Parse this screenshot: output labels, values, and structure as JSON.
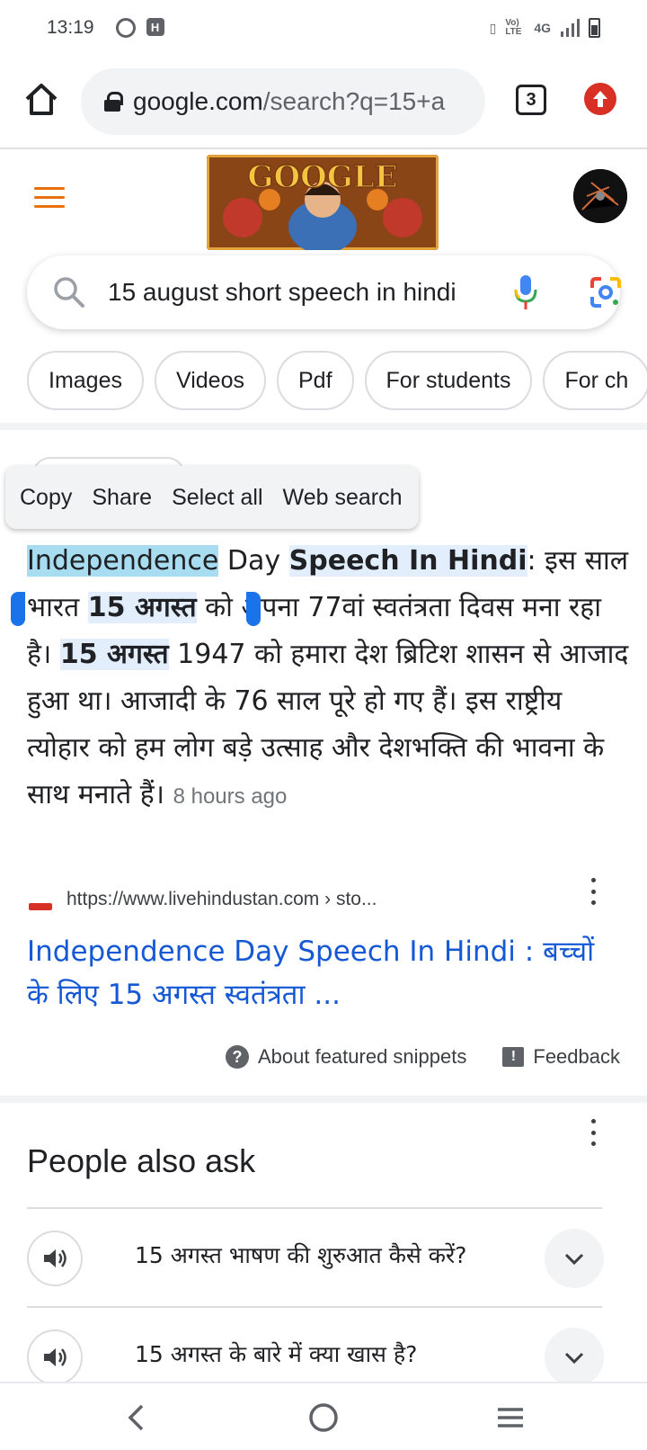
{
  "status_bar": {
    "time": "13:19",
    "network": "4G",
    "volte": "Vo) LTE"
  },
  "browser": {
    "url_host": "google.com",
    "url_rest": "/search?q=15+a",
    "tab_count": "3"
  },
  "search": {
    "query": "15 august short speech in hindi",
    "doodle_text": "GOOGLE"
  },
  "chips": [
    "Images",
    "Videos",
    "Pdf",
    "For students",
    "For ch"
  ],
  "context_menu": [
    "Copy",
    "Share",
    "Select all",
    "Web search"
  ],
  "snippet": {
    "w1": "Independence",
    "w2": " Day ",
    "w3": "Speech In Hindi",
    "w4": ": इस साल भारत ",
    "w5": "15 अगस्त",
    "w6": " को अपना 77वां स्वतंत्रता दिवस मना रहा है। ",
    "w7": "15 अगस्त",
    "w8": " 1947 को हमारा देश ब्रिटिश शासन से आजाद हुआ था। आजादी के 76 साल पूरे हो गए हैं। इस राष्ट्रीय त्योहार को हम लोग बड़े उत्साह और देशभक्ति की भावना के साथ मनाते हैं। ",
    "timestamp": "8 hours ago"
  },
  "source": {
    "url": "https://www.livehindustan.com › sto...",
    "title": "Independence Day Speech In Hindi : बच्चों के लिए 15 अगस्त स्वतंत्रता ..."
  },
  "snippet_footer": {
    "about": "About featured snippets",
    "feedback": "Feedback"
  },
  "paa": {
    "title": "People also ask",
    "questions": [
      "15 अगस्त भाषण की शुरुआत कैसे करें?",
      "15 अगस्त के बारे में क्या खास है?"
    ]
  }
}
